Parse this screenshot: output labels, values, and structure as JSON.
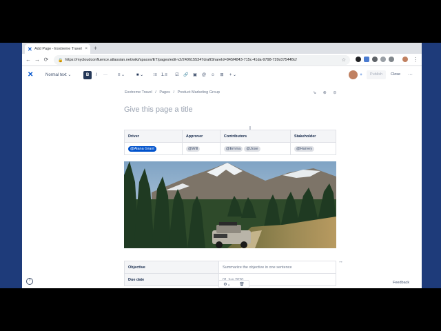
{
  "browser": {
    "tab_title": "Add Page - Exxtreme Travel - C",
    "tab_close": "×",
    "new_tab": "+",
    "back": "←",
    "forward": "→",
    "reload": "⟳",
    "url": "https://mycloudconfluence.atlassian.net/wiki/spaces/ET/pages/edit-v2/2406155347draftShareId=845f4843-715c-41da-9798-720c07544Bcf",
    "star": "☆"
  },
  "editor_toolbar": {
    "text_style": "Normal text ⌄",
    "bold": "B",
    "italic": "I",
    "more_format": "···",
    "align": "≡ ⌄",
    "color": "■ ⌄",
    "bullet_list": "⁝≡",
    "number_list": "⒈≡",
    "action_item": "☑",
    "link": "🔗",
    "image": "▣",
    "mention": "@",
    "emoji": "☺",
    "table": "⊞",
    "insert": "+ ⌄",
    "publish": "Publish",
    "close": "Close",
    "more": "···"
  },
  "breadcrumb": {
    "items": [
      "Exxtreme Travel",
      "/",
      "Pages",
      "/",
      "Product Marketing Group"
    ]
  },
  "page_actions": "⇘ ⊗ ⊝",
  "page_title_placeholder": "Give this page a title",
  "info_table": {
    "headers": [
      "Driver",
      "Approver",
      "Contributors",
      "Stakeholder"
    ],
    "driver": "@Alana Grant",
    "approver": "@Will",
    "contributors": [
      "@Emma",
      "@Jose"
    ],
    "stakeholder": "@Harvey"
  },
  "details_table": {
    "rows": [
      {
        "key": "Objective",
        "value": "Summarize the objective in one sentence"
      },
      {
        "key": "Due date",
        "value": "01 Jun 2020"
      }
    ]
  },
  "cell_tools": {
    "settings": "⚙⌄",
    "delete": "🗑"
  },
  "feedback": "Feedback",
  "cursor": "I",
  "expand": "↔",
  "help": "?"
}
